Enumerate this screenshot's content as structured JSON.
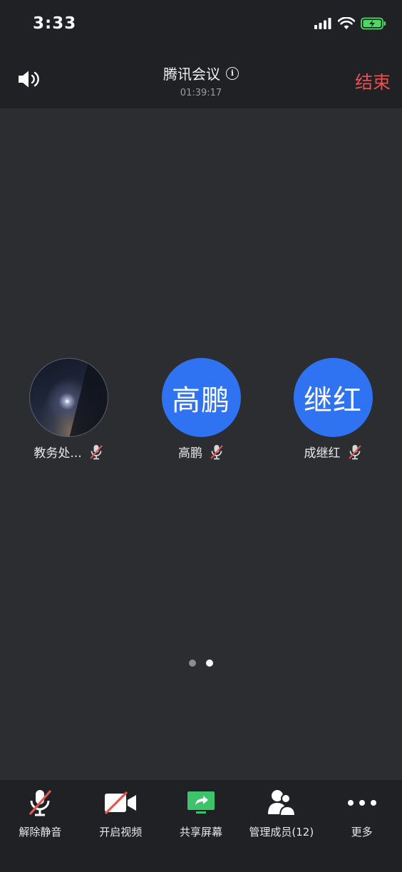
{
  "status_bar": {
    "time": "3:33"
  },
  "header": {
    "title": "腾讯会议",
    "timer": "01:39:17",
    "end_label": "结束"
  },
  "participants": [
    {
      "name": "教务处...",
      "avatar_type": "photo",
      "muted": true
    },
    {
      "name": "高鹏",
      "avatar_type": "initials",
      "avatar_text": "高鹏",
      "muted": true
    },
    {
      "name": "成继红",
      "avatar_type": "initials",
      "avatar_text": "继红",
      "muted": true
    }
  ],
  "pagination": {
    "pages": 2,
    "current": 2
  },
  "toolbar": {
    "unmute_label": "解除静音",
    "video_label": "开启视频",
    "share_label": "共享屏幕",
    "members_label": "管理成员(12)",
    "more_label": "更多"
  },
  "colors": {
    "background": "#2b2d31",
    "bar": "#202124",
    "end": "#e84f4f",
    "avatar_blue": "#2f72f2",
    "share_green": "#3ec26a",
    "mute_red": "#e0584f"
  }
}
